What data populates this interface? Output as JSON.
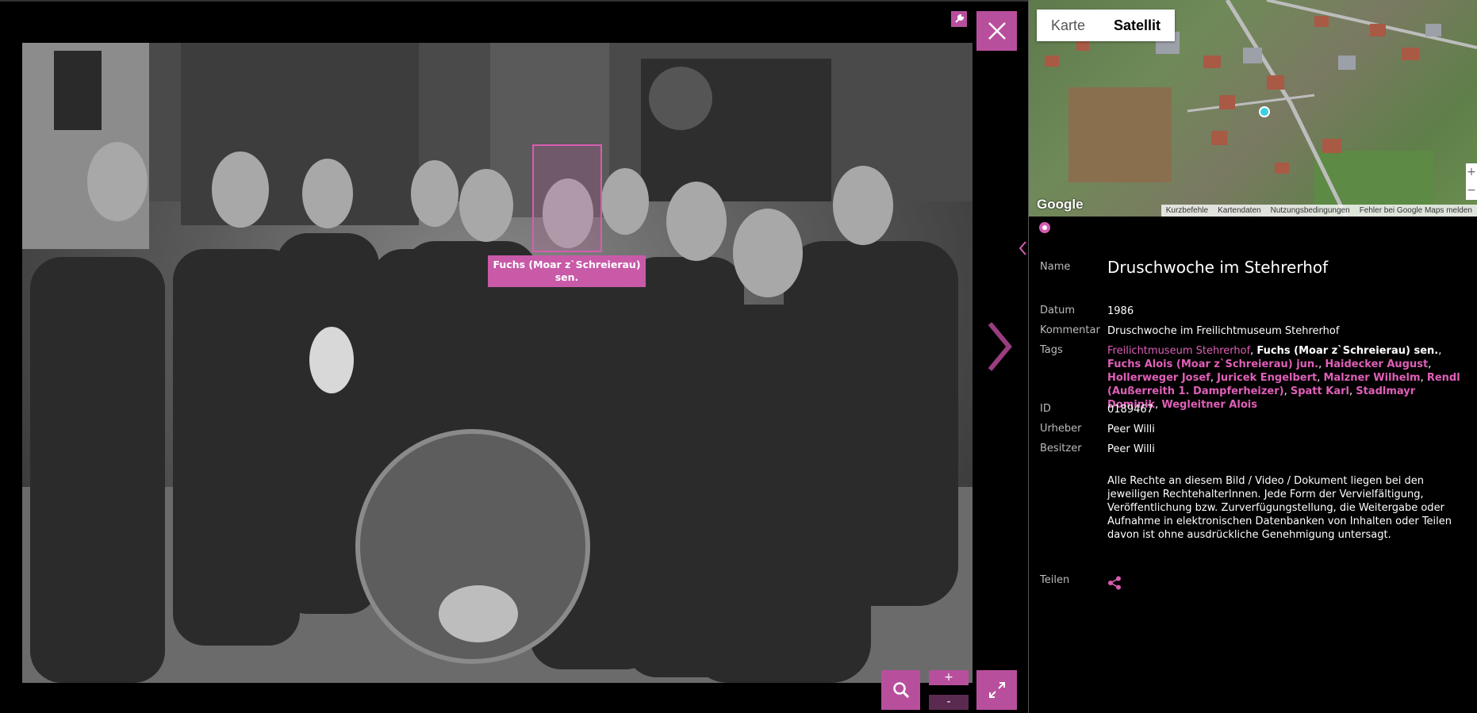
{
  "viewer": {
    "face_label": "Fuchs (Moar z`Schreierau) sen.",
    "zoom_plus": "+",
    "zoom_minus": "-",
    "icons": {
      "tool": "wrench-icon",
      "close": "close-icon",
      "search": "search-icon",
      "fullscreen": "expand-icon",
      "next": "chevron-right-icon"
    }
  },
  "map": {
    "toggle": [
      "Karte",
      "Satellit"
    ],
    "active_toggle": "Satellit",
    "google": "Google",
    "footer": [
      "Kurzbefehle",
      "Kartendaten",
      "Nutzungsbedingungen",
      "Fehler bei Google Maps melden"
    ],
    "zoom_in": "+",
    "zoom_out": "−"
  },
  "details": {
    "name_label": "Name",
    "name": "Druschwoche im Stehrerhof",
    "date_label": "Datum",
    "date": "1986",
    "comment_label": "Kommentar",
    "comment": "Druschwoche im Freilichtmuseum Stehrerhof",
    "tags_label": "Tags",
    "tags": [
      "Freilichtmuseum Stehrerhof",
      "Fuchs (Moar z`Schreierau) sen.",
      "Fuchs Alois (Moar z`Schreierau) jun.",
      "Haidecker August",
      "Hollerweger Josef",
      "Juricek Engelbert",
      "Malzner Wilhelm",
      "Rendl (Außerreith 1. Dampferheizer)",
      "Spatt Karl",
      "Stadlmayr Dominik",
      "Wegleitner Alois"
    ],
    "id_label": "ID",
    "id": "0189467",
    "creator_label": "Urheber",
    "creator": "Peer Willi",
    "owner_label": "Besitzer",
    "owner": "Peer Willi",
    "rights": "Alle Rechte an diesem Bild / Video / Dokument liegen bei den jeweiligen RechtehalterInnen. Jede Form der Vervielfältigung, Veröffentlichung bzw. Zurverfügungstellung, die Weitergabe oder Aufnahme in elektronischen Datenbanken von Inhalten oder Teilen davon ist ohne ausdrückliche Genehmigung untersagt.",
    "share_label": "Teilen"
  },
  "colors": {
    "accent": "#d65db1",
    "button": "#b84f9d"
  }
}
